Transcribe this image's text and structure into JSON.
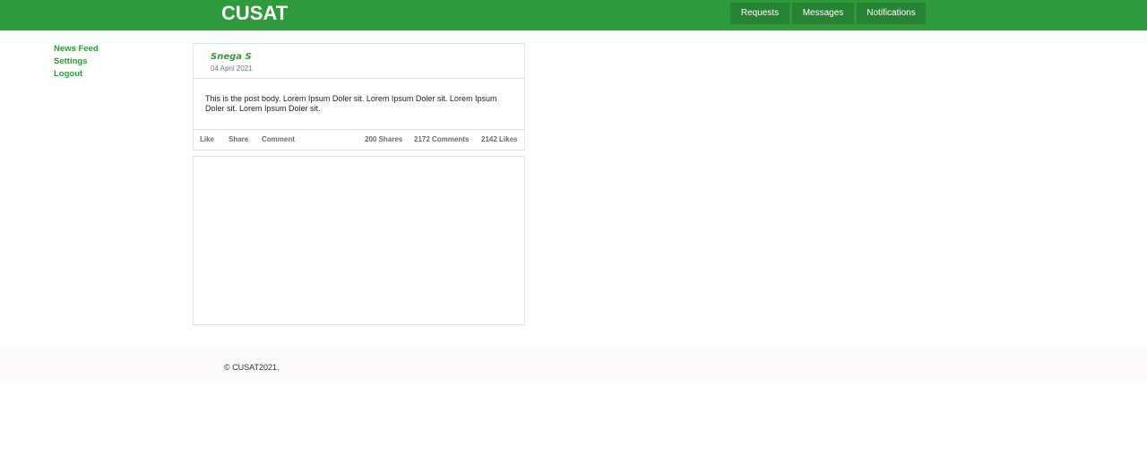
{
  "header": {
    "brand": "CUSAT",
    "nav": {
      "requests": "Requests",
      "messages": "Messages",
      "notifications": "Notifications"
    }
  },
  "sidebar": {
    "items": [
      "News Feed",
      "Settings",
      "Logout"
    ]
  },
  "post": {
    "author": "Snega S",
    "date": "04 April 2021",
    "body": "This is the post body. Lorem Ipsum Doler sit. Lorem Ipsum Doler sit. Lorem Ipsum Doler sit. Lorem Ipsum Doler sit.",
    "actions": {
      "like": "Like",
      "share": "Share",
      "comment": "Comment"
    },
    "stats": {
      "shares": "200 Shares",
      "comments": "2172 Comments",
      "likes": "2142 Likes"
    }
  },
  "footer": {
    "copyright": "© CUSAT2021."
  },
  "colors": {
    "brand_green": "#2e9a3c",
    "nav_button": "#258333",
    "footer_bg": "#fcfafa"
  }
}
